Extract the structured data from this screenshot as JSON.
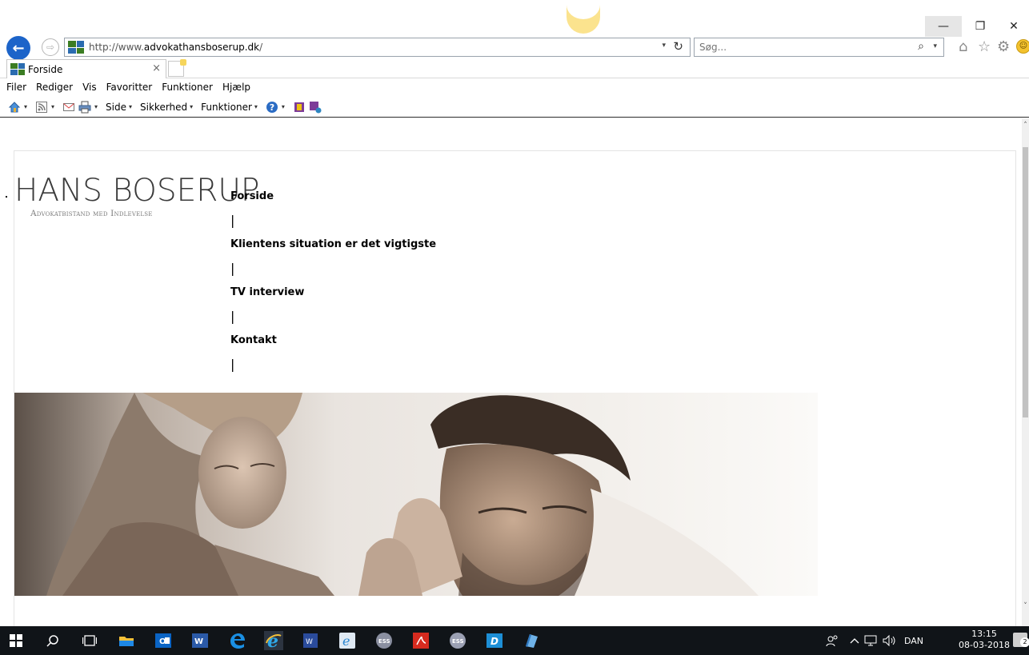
{
  "browser": {
    "url_prefix": "http://www.",
    "url_domain": "advokathansboserup.dk",
    "url_suffix": "/",
    "search_placeholder": "Søg...",
    "tab_title": "Forside",
    "tab_close": "×",
    "back_glyph": "←",
    "forward_glyph": "⇨",
    "refresh_glyph": "↻",
    "search_glyph": "⌕",
    "dropdown_glyph": "▾",
    "minimize_glyph": "—",
    "restore_glyph": "❐",
    "close_glyph": "✕",
    "home_glyph": "⌂",
    "star_glyph": "☆",
    "gear_glyph": "⚙",
    "smiley_glyph": "☺"
  },
  "menubar": {
    "items": [
      "Filer",
      "Rediger",
      "Vis",
      "Favoritter",
      "Funktioner",
      "Hjælp"
    ]
  },
  "commandbar": {
    "side_label": "Side",
    "sikkerhed_label": "Sikkerhed",
    "funktioner_label": "Funktioner",
    "caret": "▾"
  },
  "page": {
    "logo_title": "HANS BOSERUP",
    "logo_tagline": "Advokatbistand med Indlevelse",
    "nav": [
      {
        "label": "Forside"
      },
      {
        "label": "Klientens situation er det vigtigste"
      },
      {
        "label": "TV interview"
      },
      {
        "label": "Kontakt"
      }
    ],
    "nav_separator": "|"
  },
  "taskbar": {
    "language": "DAN",
    "time": "13:15",
    "date": "08-03-2018",
    "notification_count": "2"
  },
  "colors": {
    "ie_blue": "#1c64c9",
    "taskbar_bg": "#101418",
    "logo_text": "#3a3a3a",
    "tagline_text": "#7a7a7a"
  }
}
